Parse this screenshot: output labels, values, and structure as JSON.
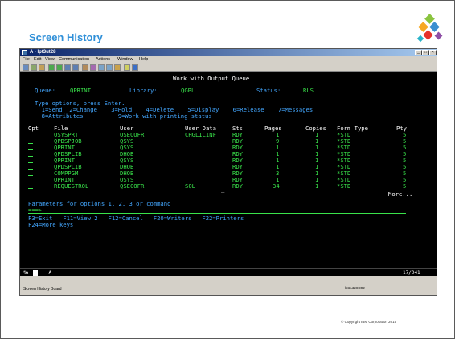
{
  "slide": {
    "title": "Screen History",
    "copyright": "© Copyright IBM Corporation 2015"
  },
  "window": {
    "title": "A - lpt3ut28",
    "controls": [
      "_",
      "□",
      "×"
    ]
  },
  "menu": [
    "File",
    "Edit",
    "View",
    "Communication",
    "Actions",
    "Window",
    "Help"
  ],
  "terminal": {
    "header": "Work with Output Queue",
    "queue_label": "Queue:",
    "queue_value": "QPRINT",
    "library_label": "Library:",
    "library_value": "QGPL",
    "status_label": "Status:",
    "status_value": "RLS",
    "instructions": "Type options, press Enter.",
    "options_line1": "  1=Send  2=Change    3=Hold    4=Delete    5=Display    6=Release    7=Messages",
    "options_line2": "  8=Attributes          9=Work with printing status",
    "columns": {
      "opt": "Opt",
      "file": "File",
      "user": "User",
      "user_data": "User Data",
      "sts": "Sts",
      "pages": "Pages",
      "copies": "Copies",
      "form_type": "Form Type",
      "pty": "Pty"
    },
    "rows": [
      {
        "file": "QSYSPRT",
        "user": "QSECOFR",
        "user_data": "CHGLICINF",
        "sts": "RDY",
        "pages": "1",
        "copies": "1",
        "form_type": "*STD",
        "pty": "5"
      },
      {
        "file": "QPDSPJOB",
        "user": "QSYS",
        "user_data": "",
        "sts": "RDY",
        "pages": "9",
        "copies": "1",
        "form_type": "*STD",
        "pty": "5"
      },
      {
        "file": "QPRINT",
        "user": "QSYS",
        "user_data": "",
        "sts": "RDY",
        "pages": "1",
        "copies": "1",
        "form_type": "*STD",
        "pty": "5"
      },
      {
        "file": "QPDSPLIB",
        "user": "DHOB",
        "user_data": "",
        "sts": "RDY",
        "pages": "1",
        "copies": "1",
        "form_type": "*STD",
        "pty": "5"
      },
      {
        "file": "QPRINT",
        "user": "QSYS",
        "user_data": "",
        "sts": "RDY",
        "pages": "1",
        "copies": "1",
        "form_type": "*STD",
        "pty": "5"
      },
      {
        "file": "QPDSPLIB",
        "user": "DHOB",
        "user_data": "",
        "sts": "RDY",
        "pages": "1",
        "copies": "1",
        "form_type": "*STD",
        "pty": "5"
      },
      {
        "file": "COMPPGM",
        "user": "DHOB",
        "user_data": "",
        "sts": "RDY",
        "pages": "3",
        "copies": "1",
        "form_type": "*STD",
        "pty": "5"
      },
      {
        "file": "QPRINT",
        "user": "QSYS",
        "user_data": "",
        "sts": "RDY",
        "pages": "1",
        "copies": "1",
        "form_type": "*STD",
        "pty": "5"
      },
      {
        "file": "REQUESTROL",
        "user": "QSECOFR",
        "user_data": "SQL",
        "sts": "RDY",
        "pages": "34",
        "copies": "1",
        "form_type": "*STD",
        "pty": "5"
      }
    ],
    "more": "More...",
    "params_label": "Parameters for options 1, 2, 3 or command",
    "prompt": "===>",
    "fkeys_line1": "F3=Exit   F11=View 2   F12=Cancel   F20=Writers   F22=Printers",
    "fkeys_line2": "F24=More keys"
  },
  "statusbar": {
    "left": "MA  +    A",
    "right": "17/041"
  },
  "bottom": {
    "left": "Screen History Board",
    "right": "lpt3ut28:992"
  },
  "colors": {
    "terminal_bg": "#000000",
    "terminal_green": "#39e24a",
    "terminal_blue": "#43a7ff",
    "terminal_white": "#ffffff",
    "title_blue": "#2f8fd8"
  }
}
